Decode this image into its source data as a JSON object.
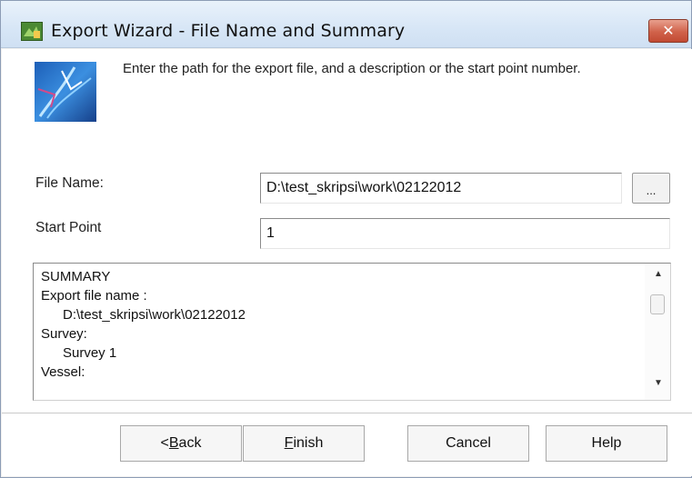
{
  "window": {
    "title": "Export Wizard - File Name and Summary",
    "close_glyph": "✕"
  },
  "intro": {
    "text": "Enter the path for the export file, and a description or the start point number."
  },
  "form": {
    "file_name_label": "File Name:",
    "file_name_value": "D:\\test_skripsi\\work\\02122012",
    "browse_label": "...",
    "start_point_label": "Start Point",
    "start_point_value": "1"
  },
  "summary": {
    "lines": [
      "SUMMARY",
      "Export file name :",
      "D:\\test_skripsi\\work\\02122012",
      "Survey:",
      "Survey 1",
      "Vessel:"
    ],
    "scroll_up_glyph": "▲",
    "scroll_down_glyph": "▼"
  },
  "buttons": {
    "back_prefix": "<",
    "back_mnemonic": "B",
    "back_rest": "ack",
    "finish_mnemonic": "F",
    "finish_rest": "inish",
    "cancel": "Cancel",
    "help": "Help"
  },
  "icons": {
    "app": "export-wizard-app-icon",
    "wizard": "wizard-graphic-icon",
    "close": "close-icon"
  },
  "colors": {
    "titlebar": "#d7e6f6",
    "close_button": "#d0624a",
    "content_background": "#ffffff"
  }
}
